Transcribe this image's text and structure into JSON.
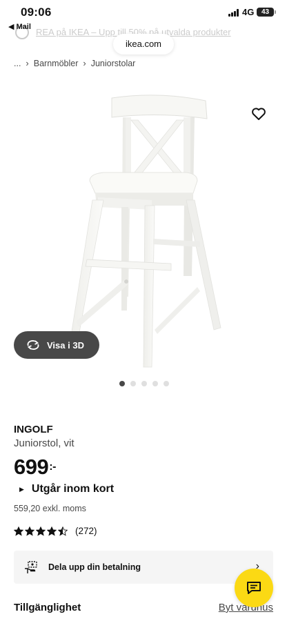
{
  "status_bar": {
    "time": "09:06",
    "back_app": "◀ Mail",
    "network": "4G",
    "battery": "43"
  },
  "browser": {
    "url": "ikea.com",
    "promo_text": "REA på IKEA – Upp till 50% på utvalda produkter"
  },
  "breadcrumb": {
    "ellipsis": "...",
    "items": [
      "Barnmöbler",
      "Juniorstolar"
    ]
  },
  "product": {
    "name": "INGOLF",
    "description": "Juniorstol, vit",
    "price": "699",
    "price_suffix": ":-",
    "stock_status": "Utgår inom kort",
    "price_excl": "559,20 exkl. moms",
    "rating": 4.5,
    "review_count": "(272)",
    "view3d_label": "Visa i 3D",
    "image_count": 5,
    "active_image": 0
  },
  "payment": {
    "label": "Dela upp din betalning"
  },
  "availability": {
    "title": "Tillgänglighet",
    "change_store": "Byt varuhus"
  },
  "colors": {
    "accent_yellow": "#fbd914",
    "dark_gray": "#484848",
    "text": "#111111"
  },
  "icons": [
    "heart-icon",
    "rotate-3d-icon",
    "star-icon",
    "payment-hand-icon",
    "chevron-right-icon",
    "chat-icon",
    "signal-icon",
    "battery-icon"
  ]
}
